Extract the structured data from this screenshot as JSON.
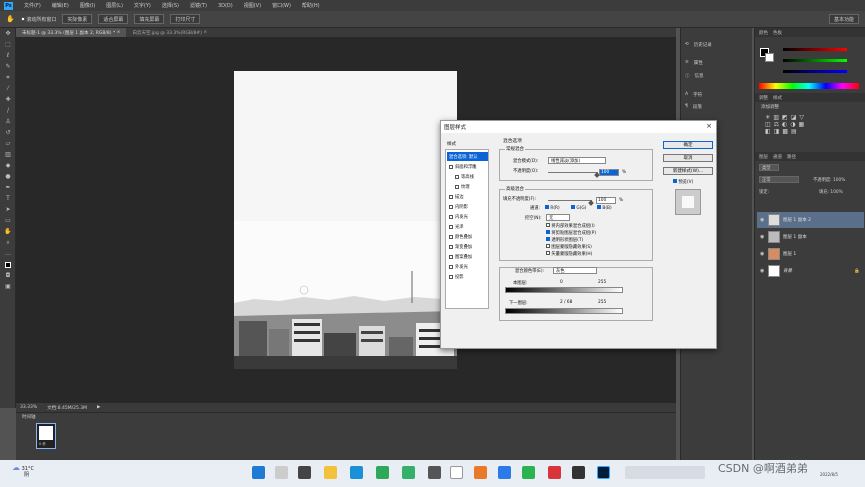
{
  "app": {
    "logo": "Ps",
    "name": "Photoshop"
  },
  "menu": [
    "文件(F)",
    "编辑(E)",
    "图像(I)",
    "图层(L)",
    "文字(Y)",
    "选择(S)",
    "滤镜(T)",
    "3D(D)",
    "视图(V)",
    "窗口(W)",
    "帮助(H)"
  ],
  "options_bar": {
    "check_label": "滚动所有窗口",
    "buttons": [
      "实际像素",
      "适合屏幕",
      "填充屏幕",
      "打印尺寸"
    ],
    "workspace": "基本功能"
  },
  "tabs": [
    {
      "label": "未标题-1 @ 33.3% (图层 1 副本 2, RGB/8) *"
    },
    {
      "label": "白云天空.jpg @ 33.3%(RGB/8#)"
    }
  ],
  "status": {
    "zoom": "33.33%",
    "doc": "文档:8.45M/25.3M"
  },
  "timeline": {
    "title": "时间轴",
    "frame_time": "0 秒"
  },
  "mini_panel": [
    "历史记录",
    "属性",
    "信息",
    "字符",
    "段落"
  ],
  "panels": {
    "color_tabs": [
      "颜色",
      "色板"
    ],
    "adjust_tabs": [
      "调整",
      "样式"
    ],
    "adjust_title": "添加调整",
    "layer_tabs": [
      "图层",
      "通道",
      "路径"
    ],
    "layer_kind": "类型",
    "blend": "正常",
    "opacity": "不透明度: 100%",
    "lock": "锁定:",
    "fill": "填充: 100%",
    "layers": [
      {
        "name": "图层 1 副本 2",
        "thumb": "#dddddd",
        "selected": true
      },
      {
        "name": "图层 1 副本",
        "thumb": "#bbbbbb",
        "selected": false
      },
      {
        "name": "图层 1",
        "thumb": "#d98c5f",
        "selected": false
      },
      {
        "name": "背景",
        "thumb": "#ffffff",
        "selected": false
      }
    ]
  },
  "dialog": {
    "title": "图层样式",
    "styles_header": "样式",
    "style_items": [
      {
        "label": "混合选项: 默认",
        "checked": null,
        "selected": true
      },
      {
        "label": "斜面和浮雕",
        "checked": false,
        "selected": false
      },
      {
        "label": "等高线",
        "checked": false,
        "selected": false
      },
      {
        "label": "纹理",
        "checked": false,
        "selected": false
      },
      {
        "label": "描边",
        "checked": false,
        "selected": false
      },
      {
        "label": "内阴影",
        "checked": false,
        "selected": false
      },
      {
        "label": "内发光",
        "checked": false,
        "selected": false
      },
      {
        "label": "光泽",
        "checked": false,
        "selected": false
      },
      {
        "label": "颜色叠加",
        "checked": false,
        "selected": false
      },
      {
        "label": "渐变叠加",
        "checked": false,
        "selected": false
      },
      {
        "label": "图案叠加",
        "checked": false,
        "selected": false
      },
      {
        "label": "外发光",
        "checked": false,
        "selected": false
      },
      {
        "label": "投影",
        "checked": false,
        "selected": false
      }
    ],
    "blend_options": "混合选项",
    "general": "常规混合",
    "blend_mode_label": "混合模式(D):",
    "blend_mode": "线性减淡(添加)",
    "opacity_label": "不透明度(O):",
    "opacity_value": "100",
    "percent": "%",
    "advanced": "高级混合",
    "fill_opacity_label": "填充不透明度(F):",
    "fill_opacity_value": "100",
    "channels_label": "通道:",
    "channels": [
      "R(R)",
      "G(G)",
      "B(B)"
    ],
    "knockout_label": "挖空(N):",
    "knockout_value": "无",
    "adv_options": [
      {
        "label": "将内部效果混合成组(I)",
        "checked": false
      },
      {
        "label": "将剪贴图层混合成组(P)",
        "checked": true
      },
      {
        "label": "透明形状图层(T)",
        "checked": true
      },
      {
        "label": "图层蒙版隐藏效果(S)",
        "checked": false
      },
      {
        "label": "矢量蒙版隐藏效果(H)",
        "checked": false
      }
    ],
    "blend_if_label": "混合颜色带(E):",
    "blend_if_value": "灰色",
    "this_layer": "本图层:",
    "this_layer_low": "0",
    "this_layer_high": "255",
    "under_layer": "下一图层:",
    "under_low": "2 / 68",
    "under_high": "255",
    "buttons": {
      "ok": "确定",
      "cancel": "取消",
      "new_style": "新建样式(W)...",
      "preview": "预览(V)"
    }
  },
  "taskbar": {
    "temp": "31°C",
    "weather": "阴",
    "time": "2022/8/5",
    "watermark": "CSDN @啊酒弟弟"
  }
}
